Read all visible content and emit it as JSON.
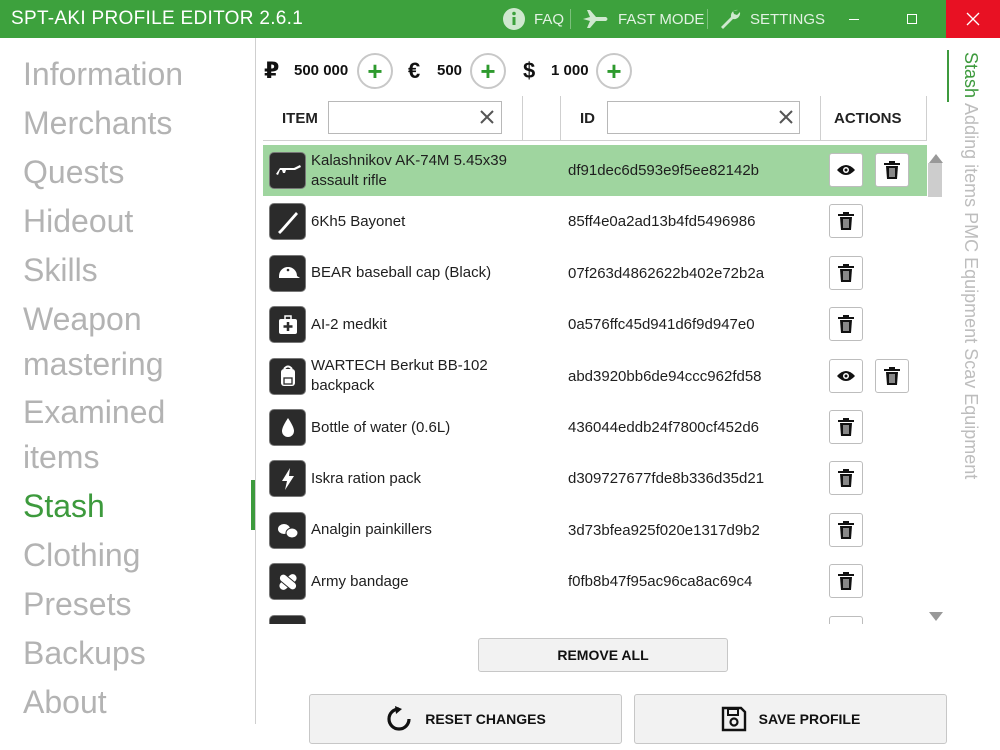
{
  "titlebar": {
    "title": "SPT-AKI PROFILE EDITOR  2.6.1",
    "faq": "FAQ",
    "fast_mode": "FAST MODE",
    "settings": "SETTINGS",
    "accent": "#3da13d"
  },
  "nav": {
    "items": [
      "Information",
      "Merchants",
      "Quests",
      "Hideout",
      "Skills",
      "Weapon",
      "mastering",
      "Examined",
      "items",
      "Stash",
      "Clothing",
      "Presets",
      "Backups",
      "About"
    ],
    "active": "Stash"
  },
  "currency": [
    {
      "symbol": "₽",
      "value": "500 000"
    },
    {
      "symbol": "€",
      "value": "500"
    },
    {
      "symbol": "$",
      "value": "1 000"
    }
  ],
  "add_symbol": "+",
  "table": {
    "col_item": "ITEM",
    "col_id": "ID",
    "col_actions": "ACTIONS",
    "item_filter": "",
    "id_filter": "",
    "rows": [
      {
        "icon": "rifle-icon",
        "name": "Kalashnikov AK-74M 5.45x39 assault rifle",
        "id": "df91dec6d593e9f5ee82142b",
        "view": true,
        "selected": true
      },
      {
        "icon": "bayonet-icon",
        "name": "6Kh5 Bayonet",
        "id": "85ff4e0a2ad13b4fd5496986",
        "view": false
      },
      {
        "icon": "cap-icon",
        "name": "BEAR baseball cap (Black)",
        "id": "07f263d4862622b402e72b2a",
        "view": false
      },
      {
        "icon": "medkit-icon",
        "name": "AI-2 medkit",
        "id": "0a576ffc45d941d6f9d947e0",
        "view": false
      },
      {
        "icon": "backpack-icon",
        "name": "WARTECH Berkut BB-102 backpack",
        "id": "abd3920bb6de94ccc962fd58",
        "view": true
      },
      {
        "icon": "water-icon",
        "name": "Bottle of water (0.6L)",
        "id": "436044eddb24f7800cf452d6",
        "view": false
      },
      {
        "icon": "ration-icon",
        "name": "Iskra ration pack",
        "id": "d309727677fde8b336d35d21",
        "view": false
      },
      {
        "icon": "pills-icon",
        "name": "Analgin painkillers",
        "id": "3d73bfea925f020e1317d9b2",
        "view": false
      },
      {
        "icon": "bandage-icon",
        "name": "Army bandage",
        "id": "f0fb8b47f95ac96ca8ac69c4",
        "view": false
      }
    ]
  },
  "side_tabs": [
    "Stash",
    "Adding items",
    "PMC Equipment",
    "Scav Equipment"
  ],
  "buttons": {
    "remove_all": "REMOVE ALL",
    "reset": "RESET CHANGES",
    "save": "SAVE PROFILE"
  }
}
